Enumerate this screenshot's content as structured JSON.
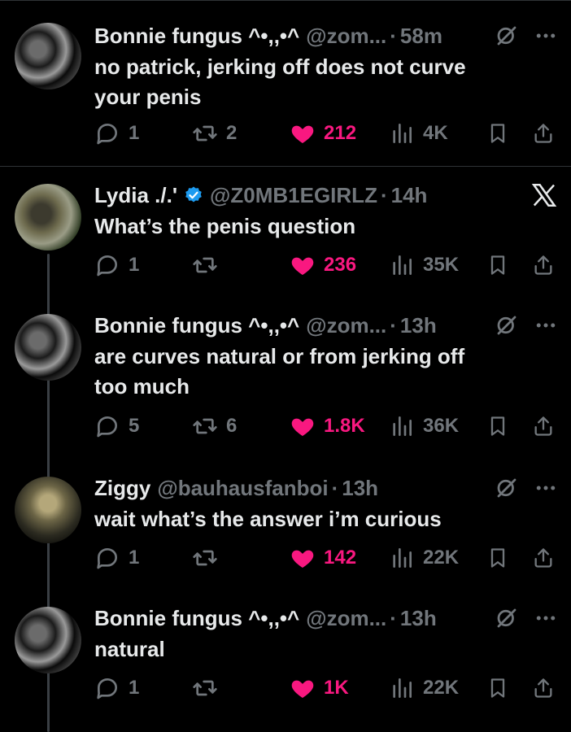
{
  "colors": {
    "background": "#000000",
    "text": "#e7e9ea",
    "muted": "#71767b",
    "like": "#f91880",
    "verified": "#1d9bf0",
    "divider": "#2f3336"
  },
  "tweets": [
    {
      "name": "Bonnie fungus ^•,,•^",
      "handle": "@zom...",
      "dot": "·",
      "time": "58m",
      "text_lines": [
        "no patrick, jerking off does not curve",
        "your penis"
      ],
      "replies": "1",
      "retweets": "2",
      "likes": "212",
      "views": "4K",
      "avatar": "bonnie-avatar",
      "header_icons": [
        "grok-icon",
        "more-icon"
      ]
    },
    {
      "name": "Lydia ./.'",
      "handle": "@Z0MB1EGIRLZ",
      "dot": "·",
      "time": "14h",
      "verified": true,
      "text_lines": [
        "What’s the penis question"
      ],
      "replies": "1",
      "retweets": "",
      "likes": "236",
      "views": "35K",
      "avatar": "lydia-avatar",
      "header_icons": [
        "x-logo"
      ]
    },
    {
      "name": "Bonnie fungus ^•,,•^",
      "handle": "@zom...",
      "dot": "·",
      "time": "13h",
      "text_lines": [
        "are curves natural or from jerking off",
        "too much"
      ],
      "replies": "5",
      "retweets": "6",
      "likes": "1.8K",
      "views": "36K",
      "avatar": "bonnie-avatar",
      "header_icons": [
        "grok-icon",
        "more-icon"
      ]
    },
    {
      "name": "Ziggy",
      "handle": "@bauhausfanboi",
      "dot": "·",
      "time": "13h",
      "text_lines": [
        "wait what’s the answer i’m curious"
      ],
      "replies": "1",
      "retweets": "",
      "likes": "142",
      "views": "22K",
      "avatar": "ziggy-avatar",
      "header_icons": [
        "grok-icon",
        "more-icon"
      ]
    },
    {
      "name": "Bonnie fungus ^•,,•^",
      "handle": "@zom...",
      "dot": "·",
      "time": "13h",
      "text_lines": [
        "natural"
      ],
      "replies": "1",
      "retweets": "",
      "likes": "1K",
      "views": "22K",
      "avatar": "bonnie-avatar",
      "header_icons": [
        "grok-icon",
        "more-icon"
      ]
    }
  ]
}
